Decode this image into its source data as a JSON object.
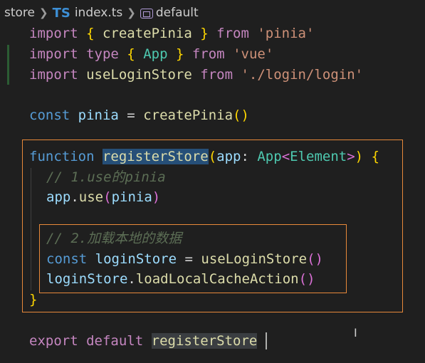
{
  "breadcrumb": {
    "folder": "store",
    "file_badge": "TS",
    "file": "index.ts",
    "symbol": "default"
  },
  "code": {
    "l1": {
      "kw1": "import",
      "b1": " { ",
      "fn": "createPinia",
      "b2": " } ",
      "kw2": "from",
      "sp": " ",
      "str": "'pinia'"
    },
    "l2": {
      "kw1": "import",
      "sp1": " ",
      "kw2": "type",
      "b1": " { ",
      "ty": "App",
      "b2": " } ",
      "kw3": "from",
      "sp2": " ",
      "str": "'vue'"
    },
    "l3": {
      "kw1": "import",
      "sp1": " ",
      "fn": "useLoginStore",
      "sp2": " ",
      "kw2": "from",
      "sp3": " ",
      "str": "'./login/login'"
    },
    "l5": {
      "dk": "const",
      "sp1": " ",
      "vr": "pinia",
      "eq": " = ",
      "fn": "createPinia",
      "paren": "()"
    },
    "l7": {
      "dk": "function",
      "sp1": " ",
      "fn": "registerStore",
      "p1": "(",
      "vr": "app",
      "colon": ": ",
      "ty": "App",
      "lt": "<",
      "ty2": "Element",
      "gt": ">",
      "p2": ")",
      "sp2": " ",
      "br": "{"
    },
    "l8": {
      "cm1": "// 1.use",
      "cm2": "的pinia"
    },
    "l9": {
      "vr": "app",
      "dot": ".",
      "fn": "use",
      "p1": "(",
      "vr2": "pinia",
      "p2": ")"
    },
    "l11": {
      "cm1": "// 2.",
      "cm2": "加载本地的数据"
    },
    "l12": {
      "dk": "const",
      "sp1": " ",
      "vr": "loginStore",
      "eq": " = ",
      "fn": "useLoginStore",
      "paren": "()"
    },
    "l13": {
      "vr": "loginStore",
      "dot": ".",
      "fn": "loadLocalCacheAction",
      "paren": "()"
    },
    "l14": {
      "br": "}"
    },
    "l16": {
      "kw1": "export",
      "sp1": " ",
      "kw2": "default",
      "sp2": " ",
      "fn": "registerStore"
    }
  },
  "colors": {
    "background": "#1f1f1f",
    "annotation_box": "#e8893a",
    "keyword_import": "#c586c0",
    "keyword_decl": "#569cd6",
    "function": "#dcdcaa",
    "variable": "#9cdcfe",
    "type": "#4ec9b0",
    "string": "#ce9178",
    "comment": "#6a9955"
  },
  "icons": {
    "separator": "chevron-right-icon",
    "symbol": "symbol-variable-icon",
    "cursor": "text-cursor-icon"
  }
}
